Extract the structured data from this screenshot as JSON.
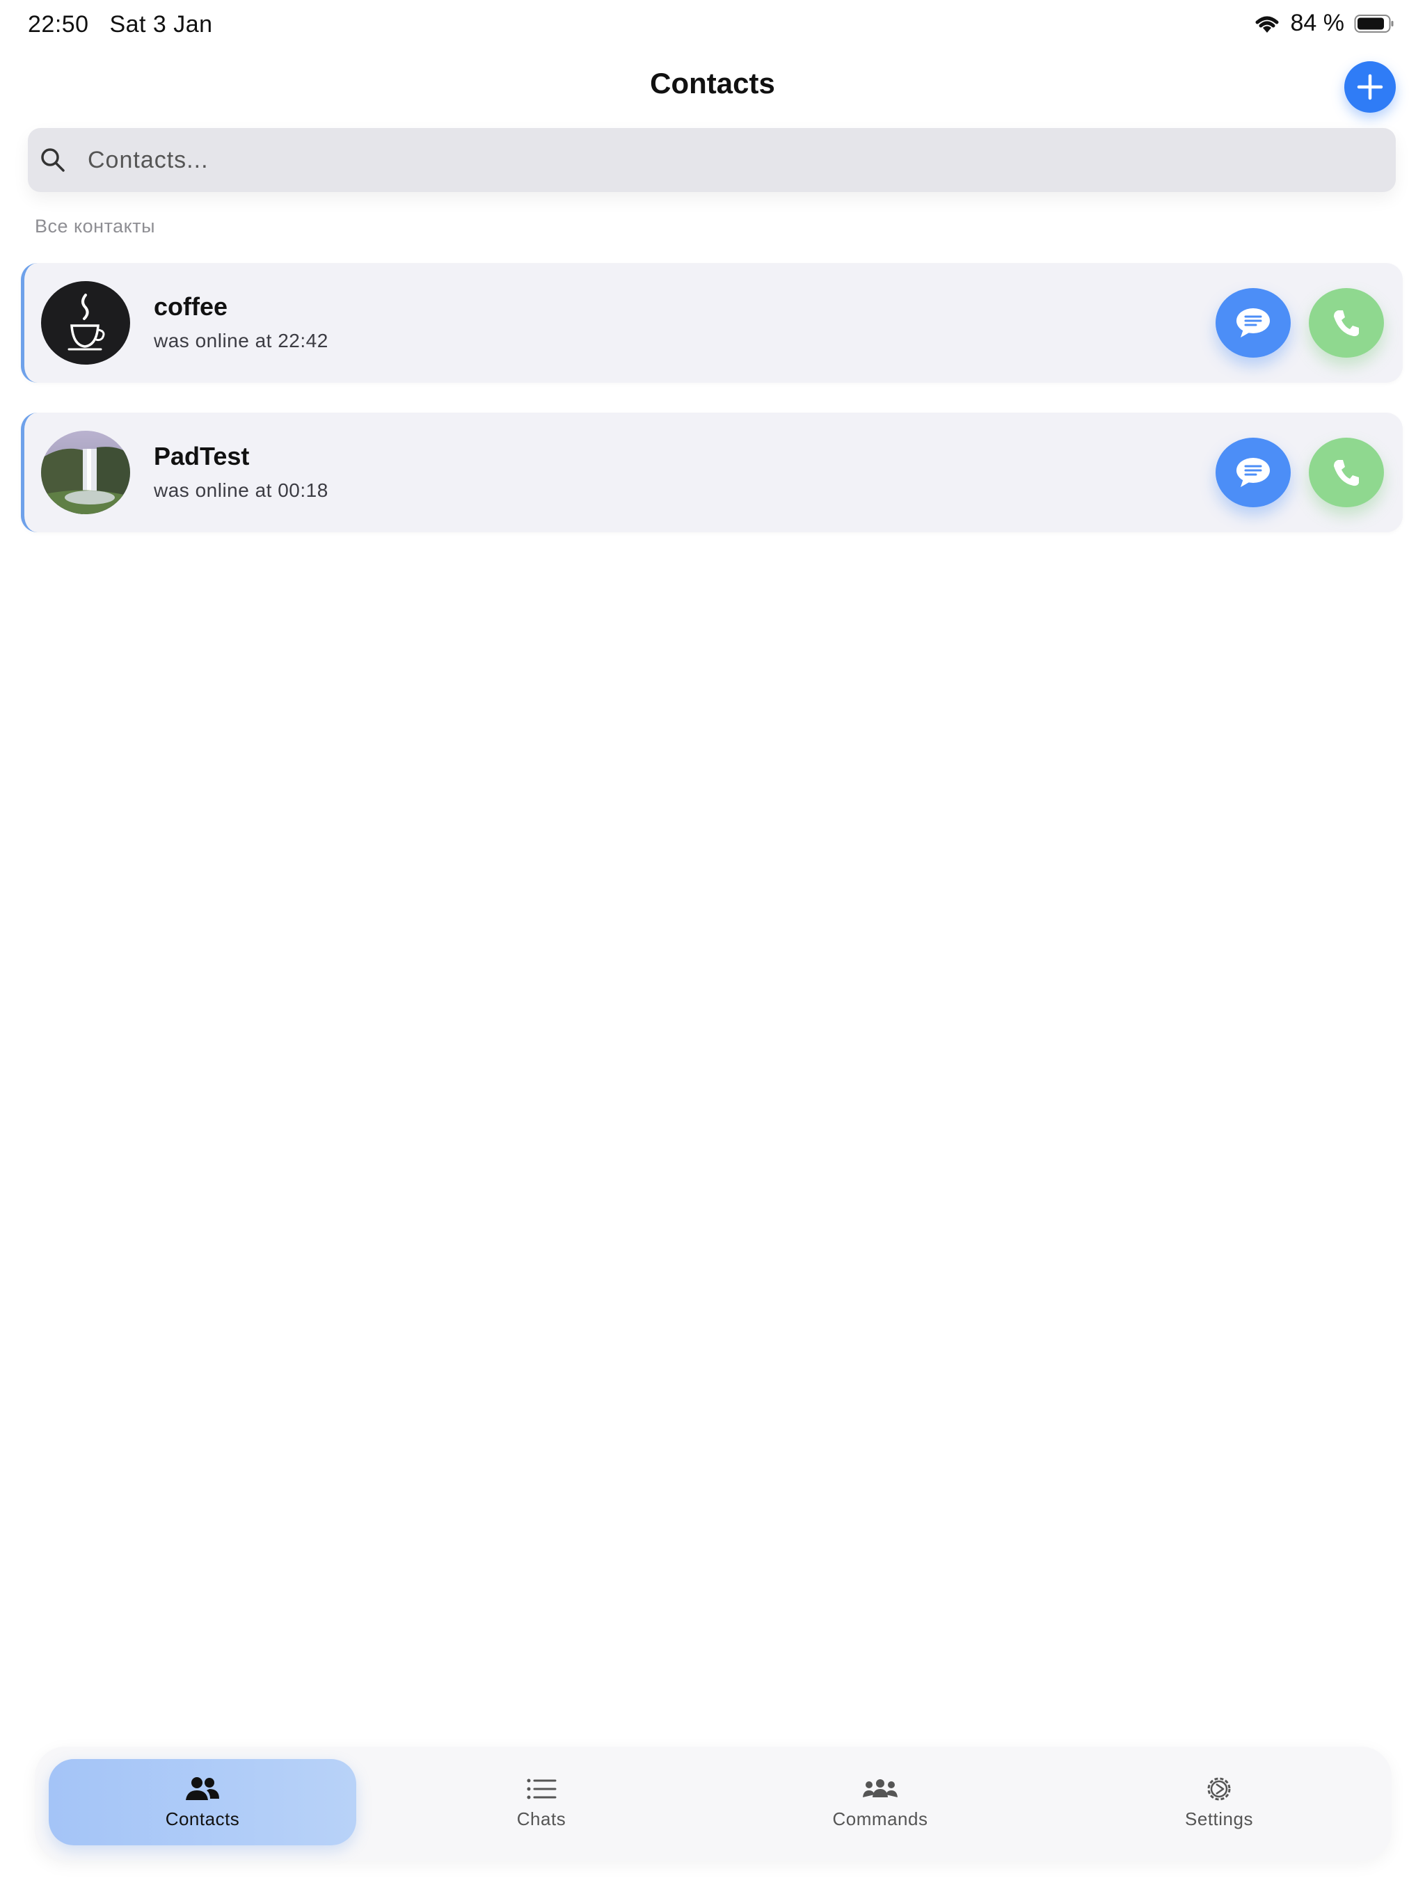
{
  "status_bar": {
    "time": "22:50",
    "date": "Sat 3 Jan",
    "battery": "84 %"
  },
  "header": {
    "title": "Contacts"
  },
  "search": {
    "placeholder": "Contacts..."
  },
  "section": {
    "label": "Все контакты"
  },
  "contacts": [
    {
      "name": "coffee",
      "status": "was online at  22:42"
    },
    {
      "name": "PadTest",
      "status": "was online at  00:18"
    }
  ],
  "tabs": [
    {
      "label": "Contacts",
      "icon": "people-icon",
      "active": true
    },
    {
      "label": "Chats",
      "icon": "list-icon",
      "active": false
    },
    {
      "label": "Commands",
      "icon": "group-icon",
      "active": false
    },
    {
      "label": "Settings",
      "icon": "gear-icon",
      "active": false
    }
  ],
  "colors": {
    "accent": "#2f7cf6",
    "chat": "#4c8ef7",
    "call": "#8fd88f",
    "active_tab": "#a4c4f7"
  }
}
